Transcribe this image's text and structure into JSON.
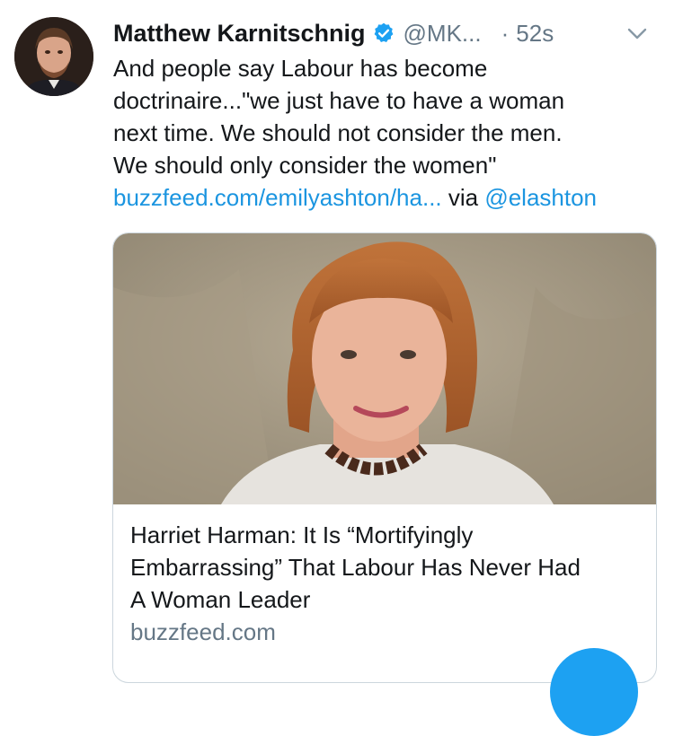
{
  "tweet": {
    "author": {
      "name": "Matthew Karnitschnig",
      "handle": "@MK...",
      "verified": true
    },
    "separator": "·",
    "time": "52s",
    "text_lines": [
      "And people say Labour has become",
      "doctrinaire...\"we just have to have a woman",
      "next time. We should not consider the men.",
      "We should only consider the women\""
    ],
    "link": "buzzfeed.com/emilyashton/ha...",
    "via": " via ",
    "via_handle": "@elashton"
  },
  "card": {
    "title_lines": [
      "Harriet Harman: It Is “Mortifyingly",
      "Embarrassing” That Labour Has Never Had",
      "A Woman Leader"
    ],
    "domain": "buzzfeed.com"
  },
  "icons": {
    "avatar": "avatar",
    "verified": "verified-badge-icon",
    "menu": "chevron-down-icon",
    "compose": "compose-fab"
  },
  "colors": {
    "accent": "#1b95e0",
    "verified": "#1da1f2",
    "secondary_text": "#657786",
    "primary_text": "#14171a"
  }
}
